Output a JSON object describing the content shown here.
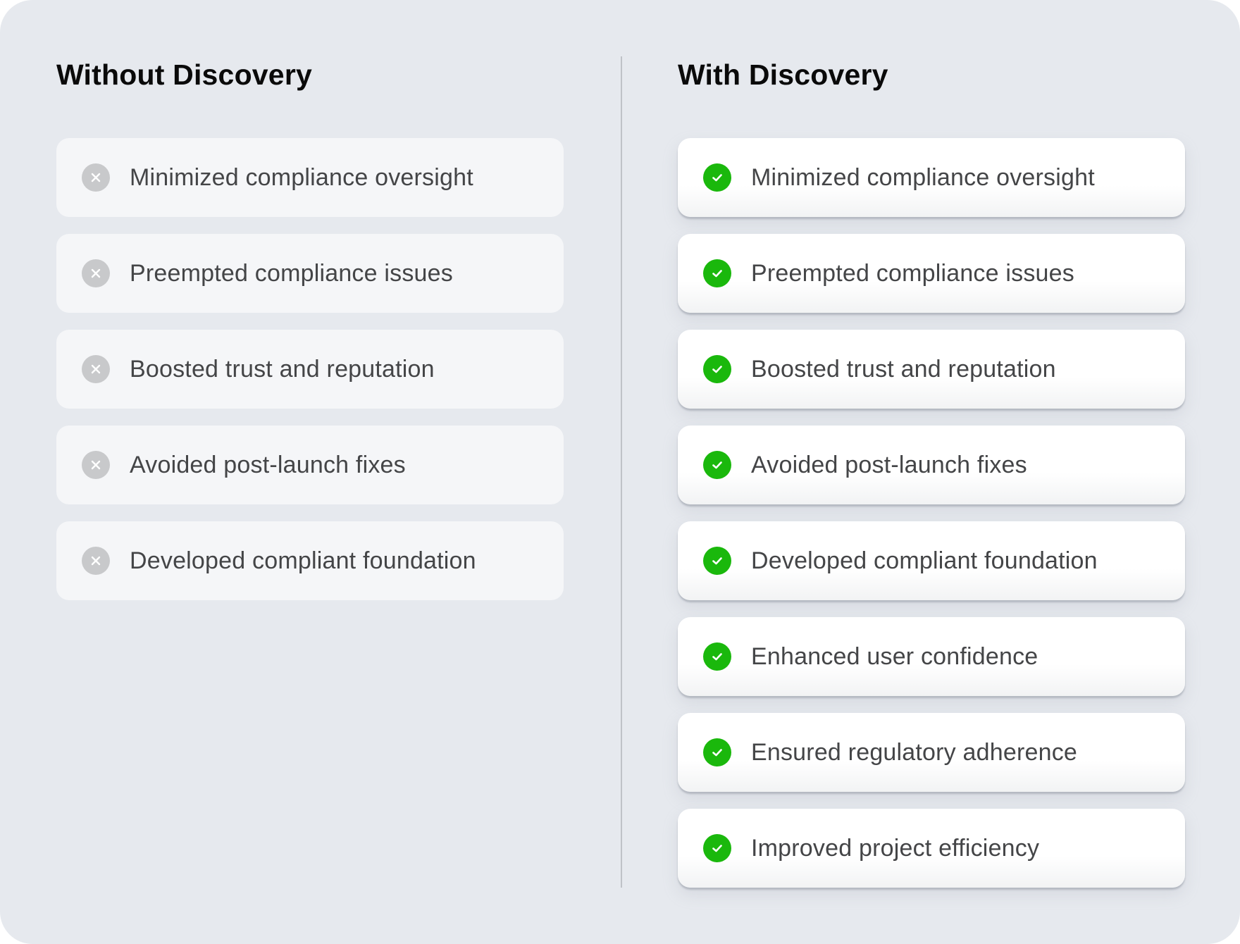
{
  "left": {
    "title": "Without Discovery",
    "icon": "x-circle-icon",
    "items": [
      {
        "label": "Minimized compliance oversight"
      },
      {
        "label": "Preempted compliance issues"
      },
      {
        "label": "Boosted trust and reputation"
      },
      {
        "label": "Avoided post-launch fixes"
      },
      {
        "label": "Developed compliant foundation"
      }
    ]
  },
  "right": {
    "title": "With Discovery",
    "icon": "check-circle-icon",
    "items": [
      {
        "label": "Minimized compliance oversight"
      },
      {
        "label": "Preempted compliance issues"
      },
      {
        "label": "Boosted trust and reputation"
      },
      {
        "label": "Avoided post-launch fixes"
      },
      {
        "label": "Developed compliant foundation"
      },
      {
        "label": "Enhanced user confidence"
      },
      {
        "label": "Ensured regulatory adherence"
      },
      {
        "label": "Improved project efficiency"
      }
    ]
  },
  "colors": {
    "background": "#e6e9ee",
    "check": "#1ab80c",
    "cross": "#c8c9cb",
    "text": "#444547",
    "heading": "#0a0a0a"
  }
}
